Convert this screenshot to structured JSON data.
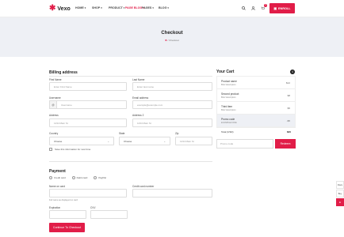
{
  "header": {
    "logo_text": "Vexo",
    "nav": [
      {
        "label": "HOME",
        "active": false
      },
      {
        "label": "SHOP",
        "active": false
      },
      {
        "label": "PRODUCT",
        "active": false
      },
      {
        "label": "PAGE BLOG",
        "active": true
      },
      {
        "label": "PAGES",
        "active": false
      },
      {
        "label": "BLOG",
        "active": false
      }
    ],
    "cart_count": "3",
    "enroll_label": "ENROLL"
  },
  "banner": {
    "title": "Checkout",
    "breadcrumb_current": "Checkout"
  },
  "billing": {
    "title": "Billing address",
    "first_name": {
      "label": "First Name",
      "placeholder": "Enter First Name"
    },
    "last_name": {
      "label": "Last Name",
      "placeholder": "Enter last name"
    },
    "username": {
      "label": "Username",
      "prefix": "@",
      "placeholder": "Username"
    },
    "email": {
      "label": "Email address",
      "placeholder": "example@example.com"
    },
    "address": {
      "label": "Address",
      "placeholder": "1234 Main St"
    },
    "address2": {
      "label": "Address 2",
      "placeholder": "1234 Main St"
    },
    "country": {
      "label": "Country",
      "value": "Choose"
    },
    "state": {
      "label": "State",
      "value": "Choose"
    },
    "zip": {
      "label": "Zip",
      "placeholder": "1234 Main St"
    },
    "save_info": "Save this information for next time"
  },
  "payment": {
    "title": "Payment",
    "methods": [
      "Credit card",
      "Debit card",
      "PayPal"
    ],
    "name_on_card": {
      "label": "Name on card",
      "hint": "Full name as displayed on card"
    },
    "card_number": {
      "label": "Credit card number"
    },
    "expiration": {
      "label": "Expiration"
    },
    "cvv": {
      "label": "CVV"
    },
    "submit_label": "Continue To Checkout"
  },
  "cart": {
    "title": "Your Cart",
    "count": "4",
    "items": [
      {
        "name": "Product name",
        "desc": "Brief description",
        "price": "$12",
        "highlight": false
      },
      {
        "name": "Second product",
        "desc": "Brief description",
        "price": "$8",
        "highlight": false
      },
      {
        "name": "Third item",
        "desc": "Brief description",
        "price": "$5",
        "highlight": false
      },
      {
        "name": "Promo code",
        "desc": "EXAMPLECODE",
        "price": "-$5",
        "highlight": true
      }
    ],
    "total_label": "Total (USD)",
    "total_value": "$20",
    "promo_placeholder": "Promo code",
    "redeem_label": "Redeem"
  },
  "side_tabs": [
    "Docs",
    "Buy"
  ],
  "colors": {
    "accent": "#e11d48",
    "banner_bg": "#eef0f5"
  }
}
